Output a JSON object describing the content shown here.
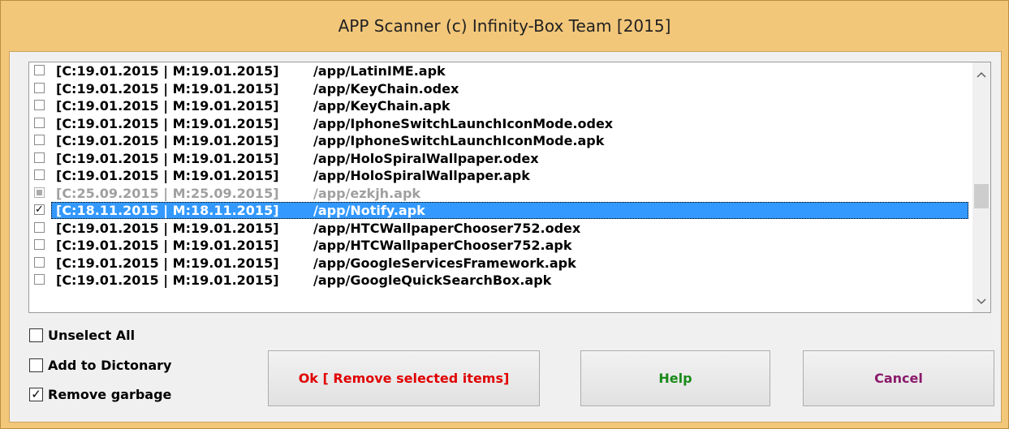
{
  "window": {
    "title": "APP Scanner (c) Infinity-Box Team [2015]"
  },
  "list": {
    "rows": [
      {
        "date": "[C:19.01.2015 | M:19.01.2015]",
        "path": "/app/LatinIME.apk",
        "state": "unchecked"
      },
      {
        "date": "[C:19.01.2015 | M:19.01.2015]",
        "path": "/app/KeyChain.odex",
        "state": "unchecked"
      },
      {
        "date": "[C:19.01.2015 | M:19.01.2015]",
        "path": "/app/KeyChain.apk",
        "state": "unchecked"
      },
      {
        "date": "[C:19.01.2015 | M:19.01.2015]",
        "path": "/app/IphoneSwitchLaunchIconMode.odex",
        "state": "unchecked"
      },
      {
        "date": "[C:19.01.2015 | M:19.01.2015]",
        "path": "/app/IphoneSwitchLaunchIconMode.apk",
        "state": "unchecked"
      },
      {
        "date": "[C:19.01.2015 | M:19.01.2015]",
        "path": "/app/HoloSpiralWallpaper.odex",
        "state": "unchecked"
      },
      {
        "date": "[C:19.01.2015 | M:19.01.2015]",
        "path": "/app/HoloSpiralWallpaper.apk",
        "state": "unchecked"
      },
      {
        "date": "[C:25.09.2015 | M:25.09.2015]",
        "path": "/app/ezkjh.apk",
        "state": "indeterminate"
      },
      {
        "date": "[C:18.11.2015 | M:18.11.2015]",
        "path": "/app/Notify.apk",
        "state": "checked",
        "selected": true
      },
      {
        "date": "[C:19.01.2015 | M:19.01.2015]",
        "path": "/app/HTCWallpaperChooser752.odex",
        "state": "unchecked"
      },
      {
        "date": "[C:19.01.2015 | M:19.01.2015]",
        "path": "/app/HTCWallpaperChooser752.apk",
        "state": "unchecked"
      },
      {
        "date": "[C:19.01.2015 | M:19.01.2015]",
        "path": "/app/GoogleServicesFramework.apk",
        "state": "unchecked"
      },
      {
        "date": "[C:19.01.2015 | M:19.01.2015]",
        "path": "/app/GoogleQuickSearchBox.apk",
        "state": "unchecked"
      }
    ]
  },
  "options": {
    "unselect_all": {
      "label": "Unselect All",
      "checked": false
    },
    "add_to_dictionary": {
      "label": "Add to Dictonary",
      "checked": false
    },
    "remove_garbage": {
      "label": "Remove garbage",
      "checked": true
    }
  },
  "buttons": {
    "ok": {
      "label": "Ok [ Remove selected items]",
      "color": "#e00000"
    },
    "help": {
      "label": "Help",
      "color": "#1a8a1a"
    },
    "cancel": {
      "label": "Cancel",
      "color": "#8a1a6a"
    }
  },
  "colors": {
    "title_bar": "#f3c77a",
    "selection": "#3399ff"
  },
  "icons": {
    "scroll_up": "chevron-up-icon",
    "scroll_down": "chevron-down-icon",
    "check": "checkmark-icon"
  }
}
